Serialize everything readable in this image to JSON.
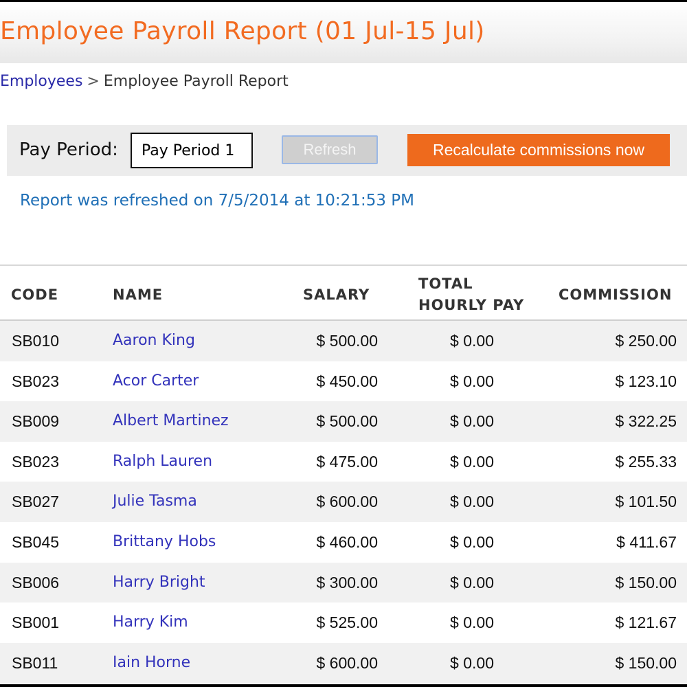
{
  "header": {
    "title": "Employee Payroll Report (01 Jul-15 Jul)"
  },
  "breadcrumb": {
    "parent": "Employees",
    "separator": ">",
    "current": "Employee Payroll Report"
  },
  "toolbar": {
    "pay_period_label": "Pay Period:",
    "pay_period_value": "Pay Period 1",
    "refresh_label": "Refresh",
    "recalculate_label": "Recalculate commissions now"
  },
  "status": {
    "refresh_message": "Report was refreshed on 7/5/2014 at 10:21:53 PM"
  },
  "table": {
    "headers": {
      "code": "CODE",
      "name": "NAME",
      "salary": "SALARY",
      "hourly_line1": "TOTAL",
      "hourly_line2": "HOURLY PAY",
      "commission": "COMMISSION"
    },
    "rows": [
      {
        "code": "SB010",
        "name": "Aaron King",
        "salary": "$ 500.00",
        "hourly": "$ 0.00",
        "commission": "$ 250.00"
      },
      {
        "code": "SB023",
        "name": "Acor Carter",
        "salary": "$ 450.00",
        "hourly": "$ 0.00",
        "commission": "$ 123.10"
      },
      {
        "code": "SB009",
        "name": "Albert Martinez",
        "salary": "$ 500.00",
        "hourly": "$ 0.00",
        "commission": "$ 322.25"
      },
      {
        "code": "SB023",
        "name": "Ralph Lauren",
        "salary": "$ 475.00",
        "hourly": "$ 0.00",
        "commission": "$ 255.33"
      },
      {
        "code": "SB027",
        "name": "Julie Tasma",
        "salary": "$ 600.00",
        "hourly": "$ 0.00",
        "commission": "$ 101.50"
      },
      {
        "code": "SB045",
        "name": "Brittany Hobs",
        "salary": "$ 460.00",
        "hourly": "$ 0.00",
        "commission": "$ 411.67"
      },
      {
        "code": "SB006",
        "name": "Harry Bright",
        "salary": "$ 300.00",
        "hourly": "$ 0.00",
        "commission": "$ 150.00"
      },
      {
        "code": "SB001",
        "name": "Harry Kim",
        "salary": "$ 525.00",
        "hourly": "$ 0.00",
        "commission": "$ 121.67"
      },
      {
        "code": "SB011",
        "name": "Iain Horne",
        "salary": "$ 600.00",
        "hourly": "$ 0.00",
        "commission": "$ 150.00"
      }
    ]
  },
  "colors": {
    "accent": "#ee6a1d",
    "title": "#f26b21",
    "link": "#3333bb",
    "status": "#1f6fb6"
  }
}
